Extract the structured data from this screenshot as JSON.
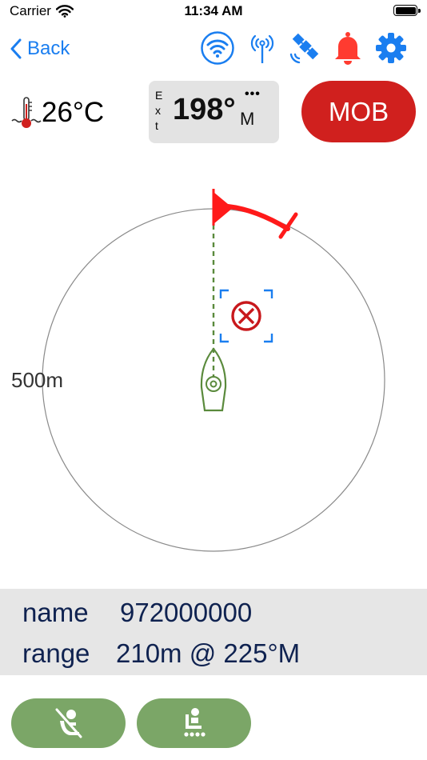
{
  "status_bar": {
    "carrier": "Carrier",
    "time": "11:34 AM"
  },
  "nav": {
    "back_label": "Back",
    "icons": [
      "wifi-icon",
      "antenna-icon",
      "satellite-icon",
      "bell-icon",
      "gear-icon"
    ],
    "accent_color": "#1a7ef0",
    "alarm_color": "#ff3b30"
  },
  "temperature": {
    "value": "26°C",
    "icon": "water-thermometer-icon"
  },
  "heading": {
    "source_letters": [
      "E",
      "x",
      "t"
    ],
    "value": "198°",
    "unit": "M",
    "more": "•••"
  },
  "mob_button": {
    "label": "MOB",
    "color": "#d0201e"
  },
  "radar": {
    "range_label": "500m",
    "target_icon": "mob-target-icon",
    "vessel_icon": "boat-icon",
    "north_marker_color": "#ff1a1a",
    "vessel_color": "#5a8a3c"
  },
  "target_info": {
    "name_label": "name",
    "name_value": "972000000",
    "range_label": "range",
    "range_value": "210m @ 225°M"
  },
  "bottom_buttons": [
    {
      "name": "person-cancel-button",
      "icon": "person-slash-icon"
    },
    {
      "name": "person-seat-button",
      "icon": "person-seat-icon"
    }
  ],
  "colors": {
    "button_green": "#7ba667",
    "panel_gray": "#e6e6e6",
    "text_navy": "#0f2250"
  }
}
